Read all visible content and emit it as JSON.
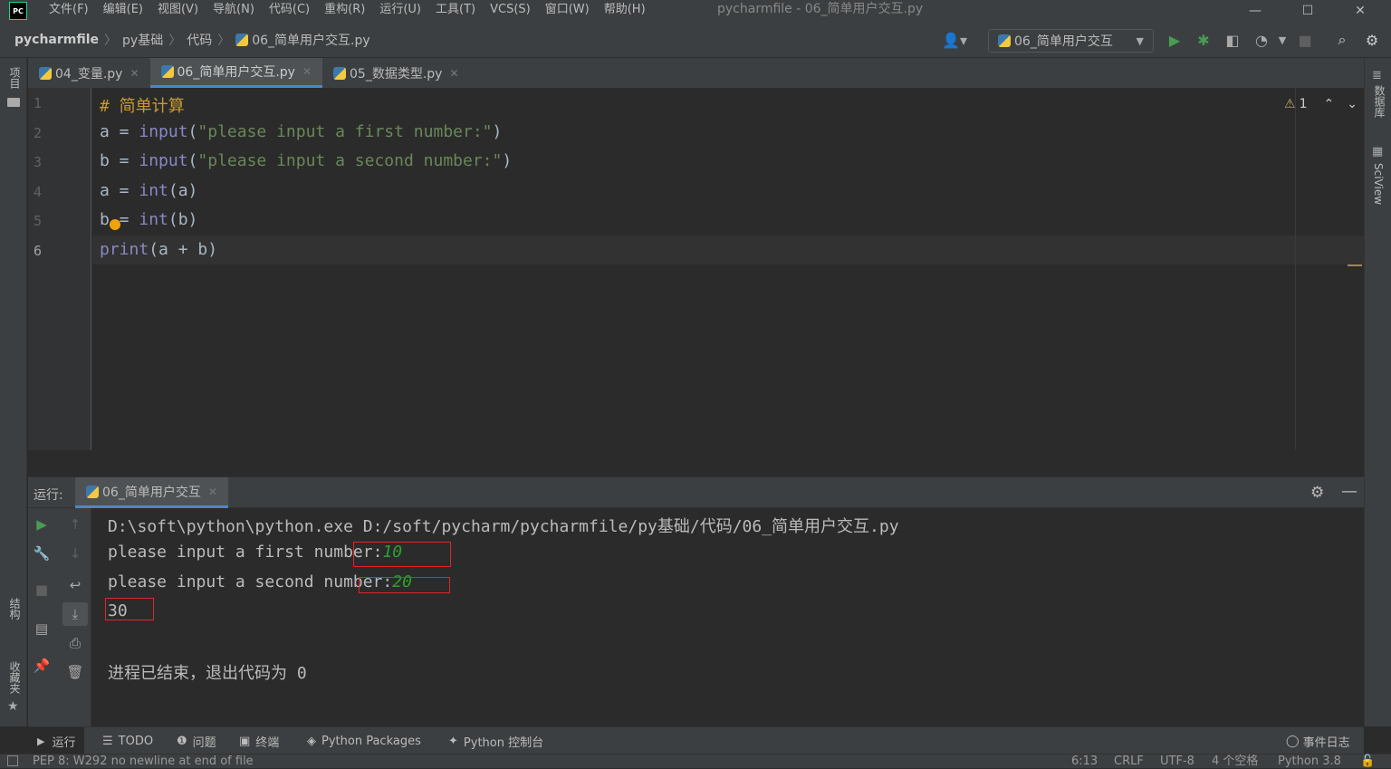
{
  "titlebar": {
    "logo": "PC",
    "menu": [
      "文件(F)",
      "编辑(E)",
      "视图(V)",
      "导航(N)",
      "代码(C)",
      "重构(R)",
      "运行(U)",
      "工具(T)",
      "VCS(S)",
      "窗口(W)",
      "帮助(H)"
    ],
    "window_title": "pycharmfile - 06_简单用户交互.py"
  },
  "navbar": {
    "crumbs": [
      "pycharmfile",
      "py基础",
      "代码",
      "06_简单用户交互.py"
    ],
    "run_config": "06_简单用户交互"
  },
  "left_stripe": {
    "project": "项目",
    "structure": "结构",
    "favorites": "收藏夹"
  },
  "right_stripe": {
    "database": "数据库",
    "sciview": "SciView"
  },
  "tabs": [
    {
      "label": "04_变量.py",
      "active": false
    },
    {
      "label": "06_简单用户交互.py",
      "active": true
    },
    {
      "label": "05_数据类型.py",
      "active": false
    }
  ],
  "editor": {
    "line_numbers": [
      "1",
      "2",
      "3",
      "4",
      "5",
      "6"
    ],
    "warnings_count": "1",
    "lines": {
      "l1_comment": "# 简单计算",
      "l2_a": "a = ",
      "l2_fn": "input",
      "l2_p1": "(",
      "l2_str": "\"please input a first number:\"",
      "l2_p2": ")",
      "l3_a": "b = ",
      "l3_fn": "input",
      "l3_p1": "(",
      "l3_str": "\"please input a second number:\"",
      "l3_p2": ")",
      "l4_a": "a = ",
      "l4_fn": "int",
      "l4_rest": "(a)",
      "l5_a": "b = ",
      "l5_fn": "int",
      "l5_rest": "(b)",
      "l6_fn": "print",
      "l6_rest": "(a + b)"
    }
  },
  "run_panel": {
    "label": "运行:",
    "tab": "06_简单用户交互",
    "output": {
      "cmd": "D:\\soft\\python\\python.exe D:/soft/pycharm/pycharmfile/py基础/代码/06_简单用户交互.py",
      "prompt1": "please input a first number:",
      "input1": "10",
      "prompt2": "please input a second number:",
      "input2": "20",
      "result": "30",
      "exit": "进程已结束，退出代码为 0"
    }
  },
  "bottom_tabs": {
    "run": "运行",
    "todo": "TODO",
    "problems": "问题",
    "terminal": "终端",
    "packages": "Python Packages",
    "console": "Python 控制台",
    "event_log": "事件日志"
  },
  "statusbar": {
    "message": "PEP 8: W292 no newline at end of file",
    "position": "6:13",
    "line_sep": "CRLF",
    "encoding": "UTF-8",
    "indent": "4 个空格",
    "interpreter": "Python 3.8"
  },
  "colors": {
    "accent": "#4a88c7",
    "run_green": "#499c54",
    "highlight_box": "#e0262a",
    "input_text": "#2fa02f"
  }
}
